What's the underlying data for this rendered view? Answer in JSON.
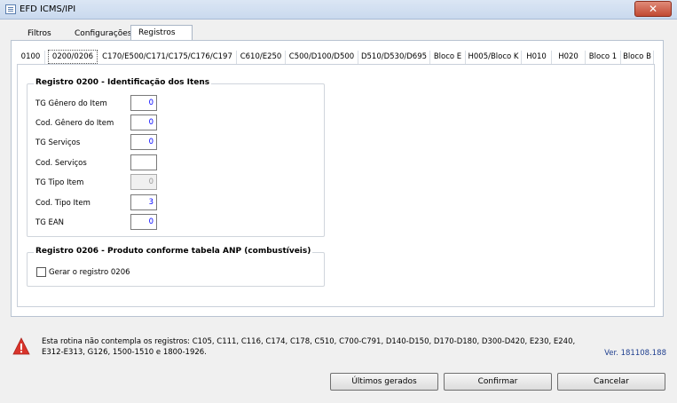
{
  "window": {
    "title": "EFD ICMS/IPI",
    "close_glyph": "✕"
  },
  "main_tabs": [
    "Filtros",
    "Configurações",
    "Registros"
  ],
  "sub_tabs": [
    "0100",
    "0200/0206",
    "C170/E500/C171/C175/C176/C197",
    "C610/E250",
    "C500/D100/D500",
    "D510/D530/D695",
    "Bloco E",
    "H005/Bloco K",
    "H010",
    "H020",
    "Bloco 1",
    "Bloco B"
  ],
  "group_0200": {
    "title": "Registro 0200 - Identificação dos Itens",
    "fields": [
      {
        "label": "TG Gênero do Item",
        "value": "0"
      },
      {
        "label": "Cod. Gênero do Item",
        "value": "0"
      },
      {
        "label": "TG Serviços",
        "value": "0"
      },
      {
        "label": "Cod. Serviços",
        "value": ""
      },
      {
        "label": "TG Tipo Item",
        "value": "0"
      },
      {
        "label": "Cod. Tipo Item",
        "value": "3"
      },
      {
        "label": "TG EAN",
        "value": "0"
      }
    ]
  },
  "group_0206": {
    "title": "Registro 0206 - Produto conforme tabela ANP (combustíveis)",
    "checkbox_label": "Gerar o registro 0206",
    "checked": false
  },
  "info": {
    "message": "Esta rotina não contempla os registros: C105, C111, C116, C174, C178, C510, C700-C791, D140-D150, D170-D180, D300-D420, E230, E240, E312-E313, G126, 1500-1510 e 1800-1926.",
    "version": "Ver. 181108.188",
    "icon": "warning-icon"
  },
  "buttons": {
    "last_generated": "Últimos gerados",
    "confirm": "Confirmar",
    "cancel": "Cancelar"
  }
}
